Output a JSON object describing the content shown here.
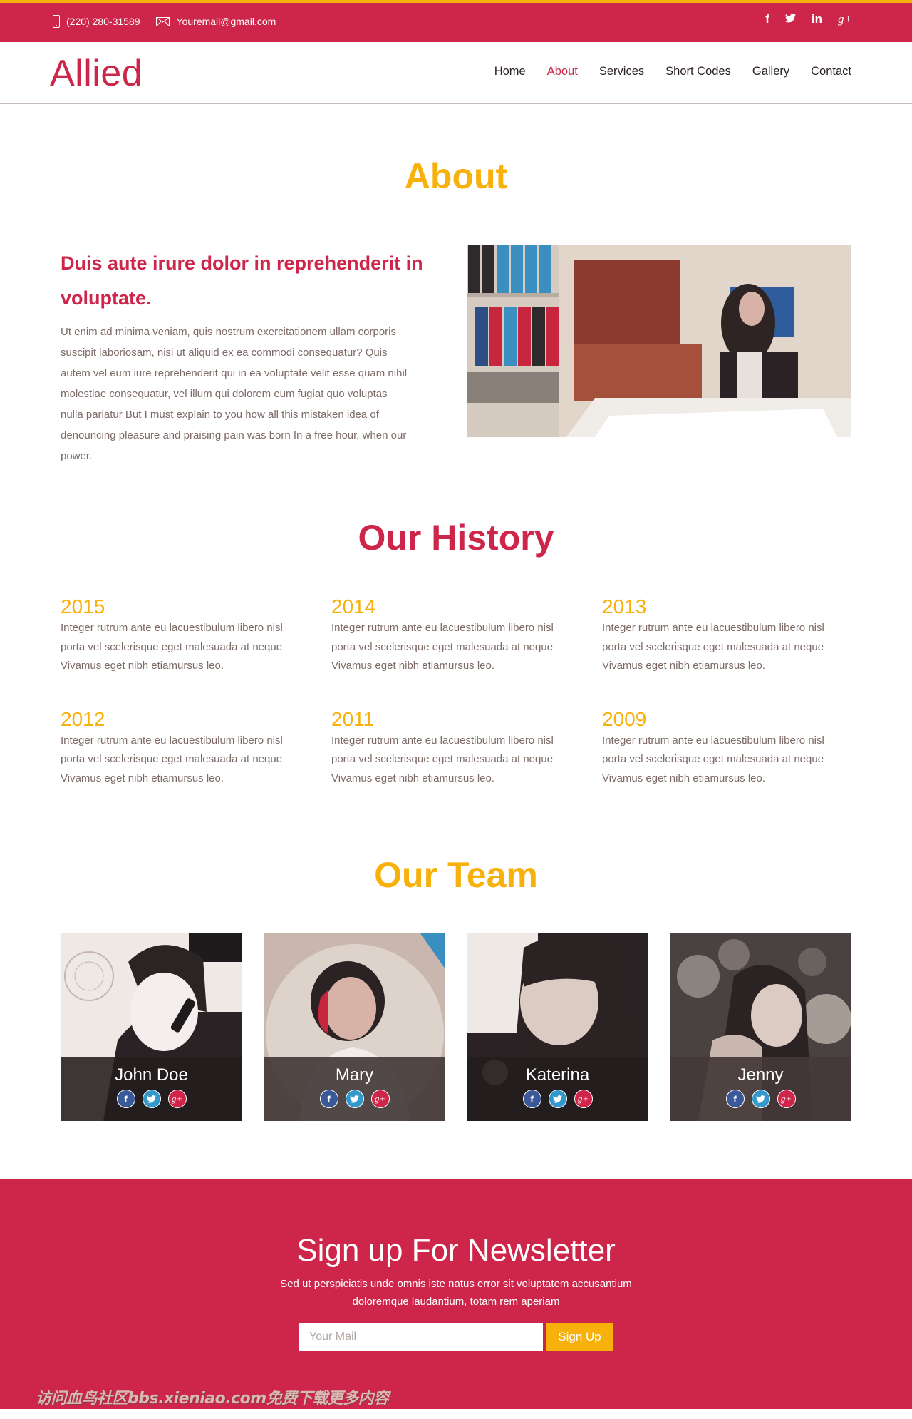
{
  "colors": {
    "brand_red": "#cd264a",
    "accent_yellow": "#f7b10a",
    "text_muted": "#7d6a66"
  },
  "topbar": {
    "phone_icon": "mobile-phone-icon",
    "phone": "(220) 280-31589",
    "email_icon": "envelope-icon",
    "email": "Youremail@gmail.com",
    "social": [
      {
        "name": "facebook-icon",
        "glyph": "f"
      },
      {
        "name": "twitter-icon",
        "glyph": "🐦"
      },
      {
        "name": "linkedin-icon",
        "glyph": "in"
      },
      {
        "name": "google-plus-icon",
        "glyph": "g+"
      }
    ]
  },
  "nav": {
    "logo": "Allied",
    "items": [
      {
        "label": "Home",
        "active": false
      },
      {
        "label": "About",
        "active": true
      },
      {
        "label": "Services",
        "active": false
      },
      {
        "label": "Short Codes",
        "active": false
      },
      {
        "label": "Gallery",
        "active": false
      },
      {
        "label": "Contact",
        "active": false
      }
    ]
  },
  "about": {
    "title": "About",
    "heading": "Duis aute irure dolor in reprehenderit in voluptate.",
    "text": "Ut enim ad minima veniam, quis nostrum exercitationem ullam corporis suscipit laboriosam, nisi ut aliquid ex ea commodi consequatur? Quis autem vel eum iure reprehenderit qui in ea voluptate velit esse quam nihil molestiae consequatur, vel illum qui dolorem eum fugiat quo voluptas nulla pariatur But I must explain to you how all this mistaken idea of denouncing pleasure and praising pain was born In a free hour, when our power.",
    "image": "office-woman-reading-photo"
  },
  "history": {
    "title": "Our History",
    "items": [
      {
        "year": "2015",
        "text": "Integer rutrum ante eu lacuestibulum libero nisl porta vel scelerisque eget malesuada at neque Vivamus eget nibh etiamursus leo."
      },
      {
        "year": "2014",
        "text": "Integer rutrum ante eu lacuestibulum libero nisl porta vel scelerisque eget malesuada at neque Vivamus eget nibh etiamursus leo."
      },
      {
        "year": "2013",
        "text": "Integer rutrum ante eu lacuestibulum libero nisl porta vel scelerisque eget malesuada at neque Vivamus eget nibh etiamursus leo."
      },
      {
        "year": "2012",
        "text": "Integer rutrum ante eu lacuestibulum libero nisl porta vel scelerisque eget malesuada at neque Vivamus eget nibh etiamursus leo."
      },
      {
        "year": "2011",
        "text": "Integer rutrum ante eu lacuestibulum libero nisl porta vel scelerisque eget malesuada at neque Vivamus eget nibh etiamursus leo."
      },
      {
        "year": "2009",
        "text": "Integer rutrum ante eu lacuestibulum libero nisl porta vel scelerisque eget malesuada at neque Vivamus eget nibh etiamursus leo."
      }
    ]
  },
  "team": {
    "title": "Our Team",
    "members": [
      {
        "name": "John Doe",
        "photo": "man-on-phone-photo"
      },
      {
        "name": "Mary",
        "photo": "woman-short-hair-photo"
      },
      {
        "name": "Katerina",
        "photo": "woman-microphone-photo"
      },
      {
        "name": "Jenny",
        "photo": "woman-smiling-photo"
      }
    ],
    "social": [
      {
        "name": "facebook-icon",
        "glyph": "f"
      },
      {
        "name": "twitter-icon",
        "glyph": "t"
      },
      {
        "name": "google-plus-icon",
        "glyph": "g+"
      }
    ]
  },
  "newsletter": {
    "title": "Sign up For Newsletter",
    "text": "Sed ut perspiciatis unde omnis iste natus error sit voluptatem accusantium doloremque laudantium, totam rem aperiam",
    "input_placeholder": "Your Mail",
    "input_value": "",
    "button": "Sign Up",
    "watermark": "访问血鸟社区bbs.xieniao.com免费下载更多内容"
  }
}
